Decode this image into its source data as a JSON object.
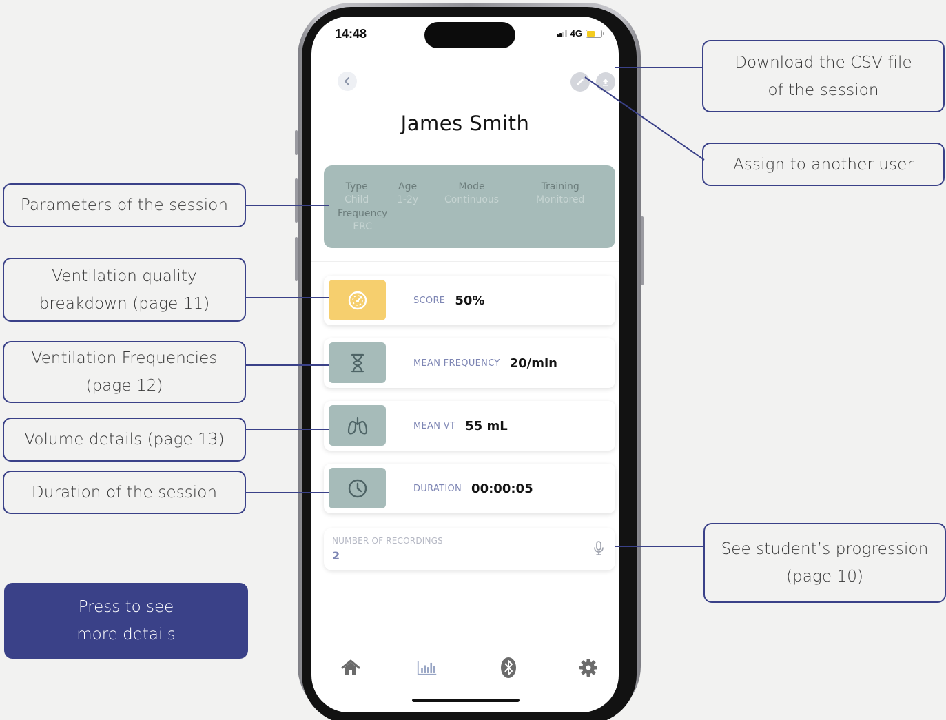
{
  "status_bar": {
    "time": "14:48",
    "network": "4G"
  },
  "header": {
    "back_icon": "chevron-left-icon",
    "edit_icon": "pencil-icon",
    "download_icon": "upload-arrow-icon",
    "student_name": "James Smith"
  },
  "parameters": {
    "type_label": "Type",
    "type_value": "Child",
    "age_label": "Age",
    "age_value": "1-2y",
    "mode_label": "Mode",
    "mode_value": "Continuous",
    "training_label": "Training",
    "training_value": "Monitored",
    "frequency_label": "Frequency",
    "frequency_value": "ERC"
  },
  "metrics": [
    {
      "label": "SCORE",
      "value": "50%",
      "icon": "speedometer-icon",
      "color": "#f6cf6e"
    },
    {
      "label": "MEAN FREQUENCY",
      "value": "20/min",
      "icon": "hourglass-icon",
      "color": "#a6bbb9"
    },
    {
      "label": "MEAN VT",
      "value": "55 mL",
      "icon": "lungs-icon",
      "color": "#a6bbb9"
    },
    {
      "label": "DURATION",
      "value": "00:00:05",
      "icon": "clock-icon",
      "color": "#a6bbb9"
    }
  ],
  "recordings": {
    "label": "NUMBER OF RECORDINGS",
    "value": "2",
    "icon": "microphone-icon"
  },
  "bottom_nav": [
    "home-icon",
    "bar-chart-icon",
    "bluetooth-icon",
    "gear-icon"
  ],
  "callouts": {
    "parameters": "Parameters of the session",
    "quality": "Ventilation quality\nbreakdown (page 11)",
    "frequencies": "Ventilation Frequencies\n(page 12)",
    "volume": "Volume details (page 13)",
    "duration": "Duration of the session",
    "download": "Download the CSV file\nof the session",
    "assign": "Assign to another user",
    "progression": "See student’s progression\n(page 10)",
    "more_details": "Press to see\nmore details"
  },
  "colors": {
    "accent": "#3a4188",
    "score": "#f6cf6e",
    "metric_icon_bg": "#a6bbb9"
  }
}
